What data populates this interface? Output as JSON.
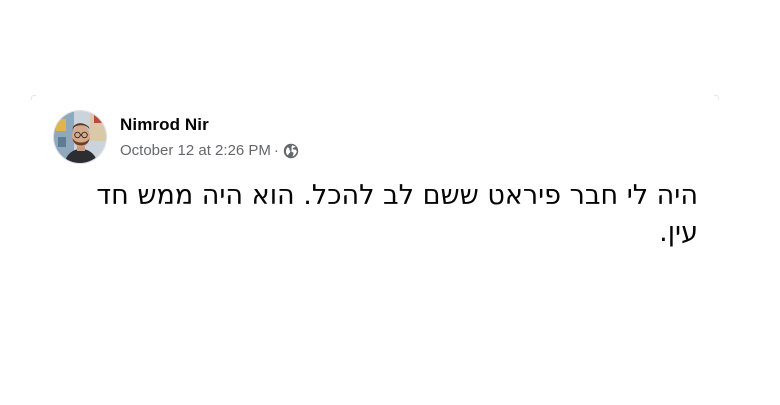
{
  "post": {
    "author_name": "Nimrod Nir",
    "timestamp": "October 12 at 2:26 PM",
    "separator": "·",
    "privacy_icon": "globe-icon",
    "avatar_icon": "profile-photo",
    "text": "היה לי חבר פיראט ששם לב להכל. הוא היה ממש חד עין."
  },
  "colors": {
    "name": "#050505",
    "meta": "#65676b",
    "background": "#ffffff"
  }
}
